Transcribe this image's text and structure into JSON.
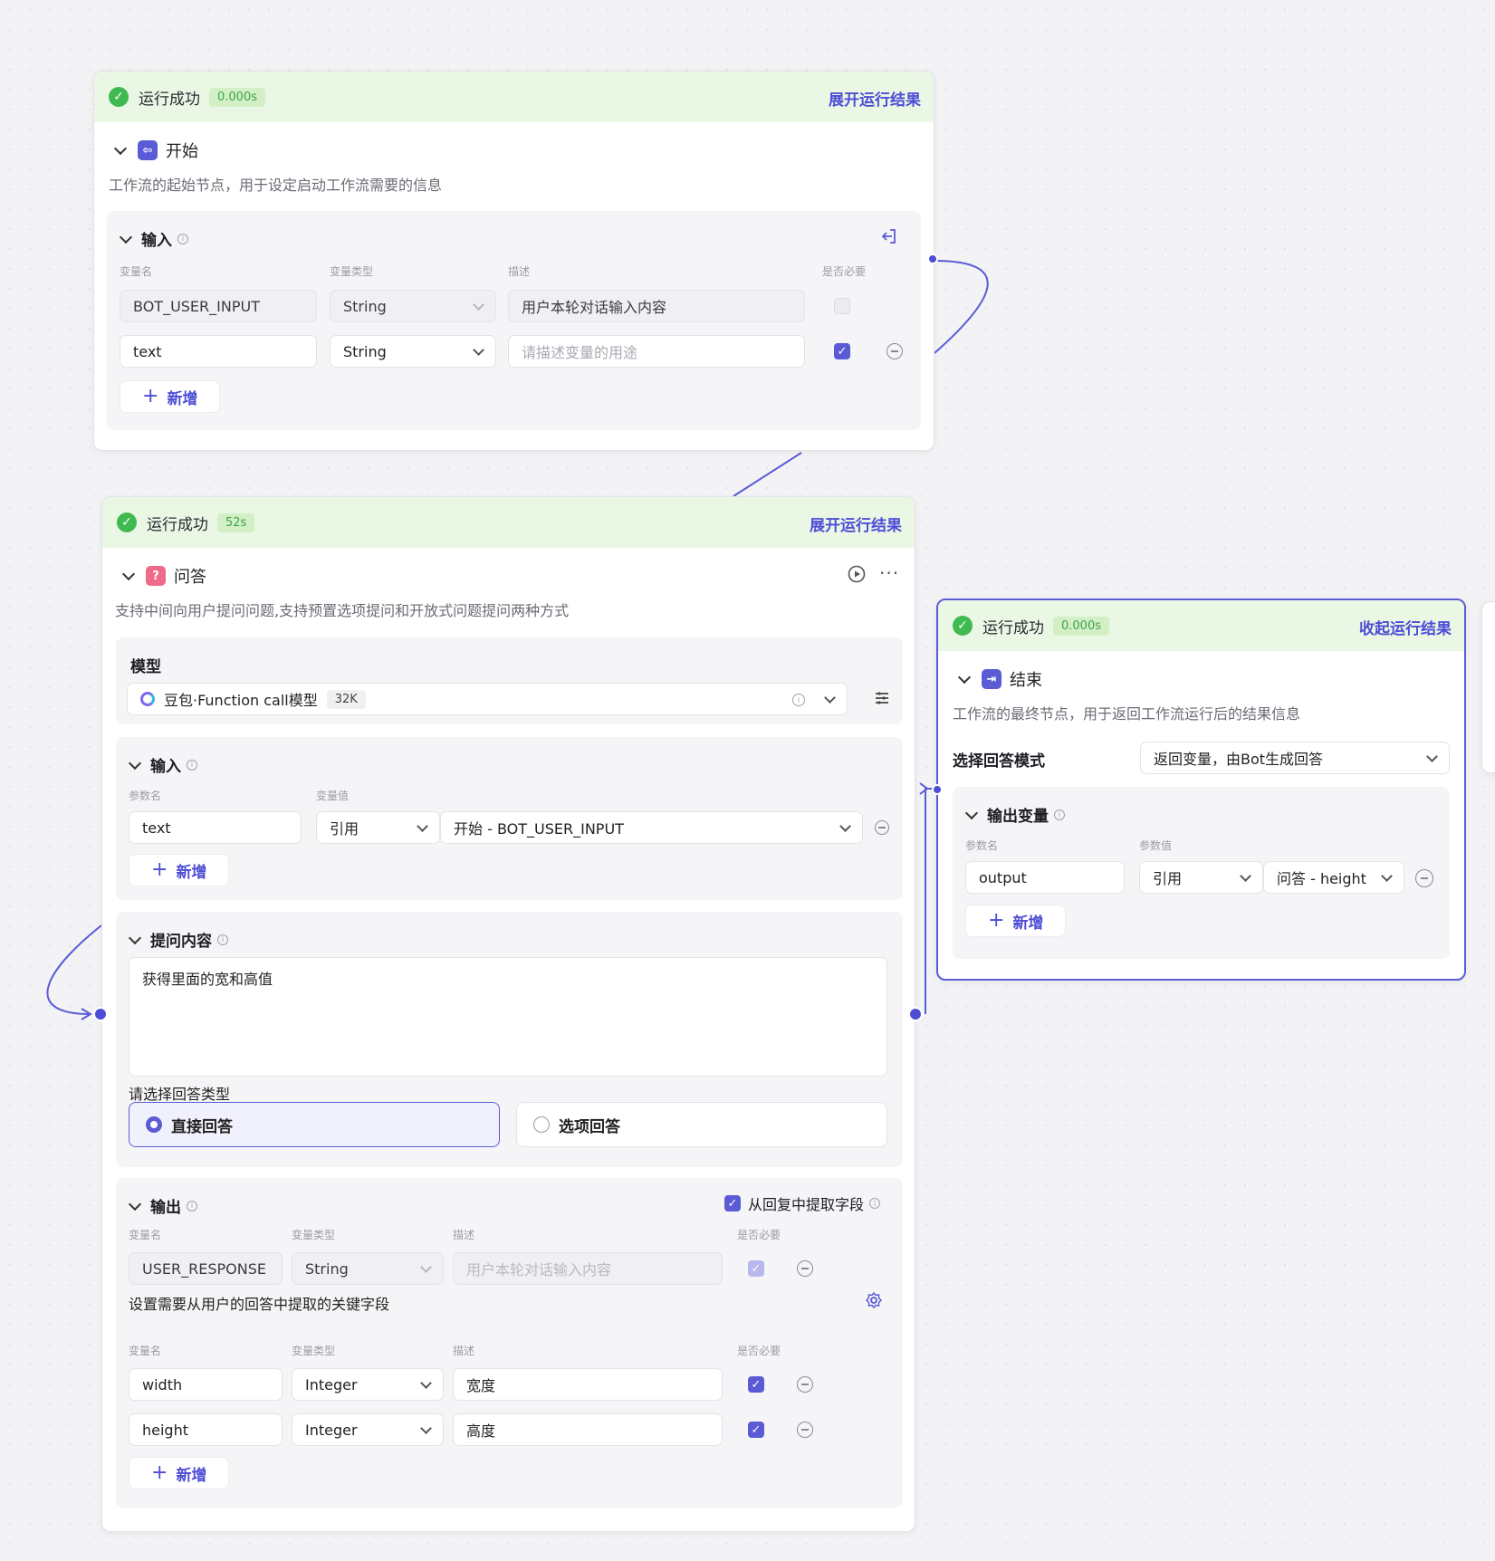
{
  "start_node": {
    "status": "运行成功",
    "time": "0.000s",
    "toggle": "展开运行结果",
    "title": "开始",
    "desc": "工作流的起始节点，用于设定启动工作流需要的信息",
    "input": {
      "title": "输入",
      "cols": [
        "变量名",
        "变量类型",
        "描述",
        "是否必要"
      ],
      "rows": [
        {
          "name": "BOT_USER_INPUT",
          "type": "String",
          "desc": "用户本轮对话输入内容",
          "required": false
        },
        {
          "name": "text",
          "type": "String",
          "desc_placeholder": "请描述变量的用途",
          "required": true
        }
      ],
      "add": "新增"
    }
  },
  "qa_node": {
    "status": "运行成功",
    "time": "52s",
    "toggle": "展开运行结果",
    "title": "问答",
    "desc": "支持中间向用户提问问题,支持预置选项提问和开放式问题提问两种方式",
    "model": {
      "title": "模型",
      "name": "豆包·Function call模型",
      "ctx": "32K"
    },
    "input": {
      "title": "输入",
      "cols": [
        "参数名",
        "变量值"
      ],
      "row": {
        "name": "text",
        "ref": "引用",
        "value": "开始 - BOT_USER_INPUT"
      },
      "add": "新增"
    },
    "question": {
      "title": "提问内容",
      "text": "获得里面的宽和高值",
      "answer_type_label": "请选择回答类型",
      "options": [
        "直接回答",
        "选项回答"
      ]
    },
    "output": {
      "title": "输出",
      "extract_label": "从回复中提取字段",
      "cols": [
        "变量名",
        "变量类型",
        "描述",
        "是否必要"
      ],
      "response_row": {
        "name": "USER_RESPONSE",
        "type": "String",
        "desc_placeholder": "用户本轮对话输入内容"
      },
      "extract_hint": "设置需要从用户的回答中提取的关键字段",
      "fields": [
        {
          "name": "width",
          "type": "Integer",
          "desc": "宽度"
        },
        {
          "name": "height",
          "type": "Integer",
          "desc": "高度"
        }
      ],
      "add": "新增"
    }
  },
  "end_node": {
    "status": "运行成功",
    "time": "0.000s",
    "toggle": "收起运行结果",
    "title": "结束",
    "desc": "工作流的最终节点，用于返回工作流运行后的结果信息",
    "mode_label": "选择回答模式",
    "mode_value": "返回变量，由Bot生成回答",
    "output": {
      "title": "输出变量",
      "cols": [
        "参数名",
        "参数值"
      ],
      "row": {
        "name": "output",
        "ref": "引用",
        "value": "问答 - height"
      },
      "add": "新增"
    }
  },
  "colors": {
    "accent": "#5b5bd6",
    "success": "#3fb950",
    "success_bg": "#eaf7e4"
  }
}
